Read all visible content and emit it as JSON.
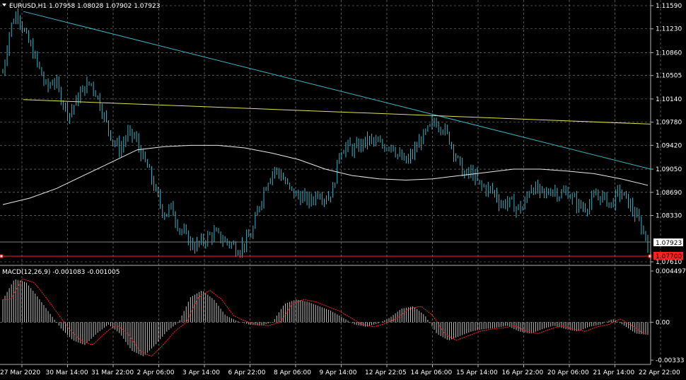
{
  "chart_data": [
    {
      "type": "candlestick",
      "title": "EURUSD,H1  1.07958 1.08028 1.07902 1.07923",
      "symbol": "EURUSD,H1",
      "ohlc_header": [
        "1.07958",
        "1.08028",
        "1.07902",
        "1.07923"
      ],
      "y_ticks": [
        "1.11590",
        "1.11230",
        "1.10860",
        "1.10505",
        "1.10140",
        "1.09780",
        "1.09420",
        "1.09050",
        "1.08690",
        "1.08330",
        "1.07610"
      ],
      "ylim": [
        1.0761,
        1.1159
      ],
      "x_ticks": [
        "27 Mar 2020",
        "30 Mar 14:00",
        "31 Mar 22:00",
        "2 Apr 06:00",
        "3 Apr 14:00",
        "6 Apr 22:00",
        "8 Apr 06:00",
        "9 Apr 14:00",
        "12 Apr 22:05",
        "14 Apr 06:00",
        "15 Apr 14:00",
        "16 Apr 22:00",
        "20 Apr 06:00",
        "21 Apr 14:00",
        "22 Apr 22:00"
      ],
      "current_price": "1.07923",
      "marked_level": "1.07700",
      "close_path": [
        1.1055,
        1.1125,
        1.115,
        1.1115,
        1.109,
        1.106,
        1.103,
        1.1045,
        1.1015,
        1.099,
        1.101,
        1.103,
        1.104,
        1.1015,
        1.098,
        1.095,
        1.0935,
        1.096,
        1.0955,
        1.0925,
        1.09,
        1.0865,
        1.0835,
        1.0845,
        1.0815,
        1.08,
        1.0785,
        1.079,
        1.08,
        1.0805,
        1.0795,
        1.079,
        1.078,
        1.079,
        1.0805,
        1.085,
        1.0885,
        1.0905,
        1.0895,
        1.0875,
        1.0865,
        1.086,
        1.0855,
        1.087,
        1.086,
        1.087,
        1.0935,
        1.094,
        1.0935,
        1.0945,
        1.095,
        1.0945,
        1.094,
        1.0945,
        1.0925,
        1.0915,
        1.093,
        1.095,
        1.0965,
        1.098,
        1.097,
        1.095,
        1.092,
        1.0895,
        1.09,
        1.088,
        1.0875,
        1.087,
        1.085,
        1.0855,
        1.0845,
        1.0845,
        1.088,
        1.087,
        1.0865,
        1.0875,
        1.0865,
        1.087,
        1.0855,
        1.0845,
        1.085,
        1.0865,
        1.086,
        1.085,
        1.087,
        1.086,
        1.084,
        1.0818,
        1.0792
      ],
      "moving_average": [
        1.085,
        1.086,
        1.0875,
        1.0895,
        1.0915,
        1.0935,
        1.094,
        1.0942,
        1.0942,
        1.0938,
        1.093,
        1.092,
        1.0905,
        1.0895,
        1.089,
        1.0888,
        1.089,
        1.0895,
        1.09,
        1.0905,
        1.0905,
        1.0902,
        1.0898,
        1.089,
        1.088
      ],
      "trendlines": [
        {
          "name": "blue-trendline",
          "color": "#3bb3c4",
          "from": [
            "27 Mar 2020",
            1.115
          ],
          "to": [
            "22 Apr 22:00",
            1.0905
          ]
        },
        {
          "name": "yellow-trendline",
          "color": "#e1e15a",
          "from": [
            "27 Mar 2020",
            1.1013
          ],
          "to": [
            "22 Apr 22:00",
            1.0975
          ]
        }
      ]
    },
    {
      "type": "bar",
      "title": "MACD(12,26,9) -0.001083 -0.001005",
      "label": "MACD(12,26,9)",
      "values": [
        "-0.001083",
        "-0.001005"
      ],
      "y_ticks": [
        "0.004497",
        "0.00",
        "-0.00333"
      ],
      "ylim": [
        -0.00333,
        0.004497
      ],
      "histogram_path": [
        0.002,
        0.0038,
        0.0035,
        0.0022,
        0.0008,
        -0.0006,
        -0.0016,
        -0.002,
        -0.001,
        -0.0002,
        -0.001,
        -0.0025,
        -0.003,
        -0.002,
        -0.0008,
        0.0,
        0.0022,
        0.0028,
        0.002,
        0.0006,
        0.0001,
        -0.0002,
        -0.0003,
        0.0,
        0.0016,
        0.002,
        0.0018,
        0.0014,
        0.001,
        0.0004,
        -0.0002,
        -0.0004,
        -0.0001,
        0.0004,
        0.0012,
        0.0014,
        0.0006,
        -0.001,
        -0.0016,
        -0.0012,
        -0.0008,
        -0.0006,
        -0.0005,
        -0.0003,
        -0.0008,
        -0.001,
        -0.0006,
        -0.0003,
        -0.0006,
        -0.0008,
        -0.0004,
        -0.0002,
        0.0003,
        -0.0003,
        -0.001,
        -0.0011
      ]
    }
  ],
  "colors": {
    "background": "#000000",
    "grid": "#8a8a8a",
    "candle": "#3bb3c4",
    "moving_average": "#e8e8e8",
    "blue_trendline": "#3bb3c4",
    "yellow_trendline": "#e1e15a",
    "level_line": "#ff2020",
    "macd_bars": "#c0c0c0",
    "macd_signal": "#ff2020"
  }
}
